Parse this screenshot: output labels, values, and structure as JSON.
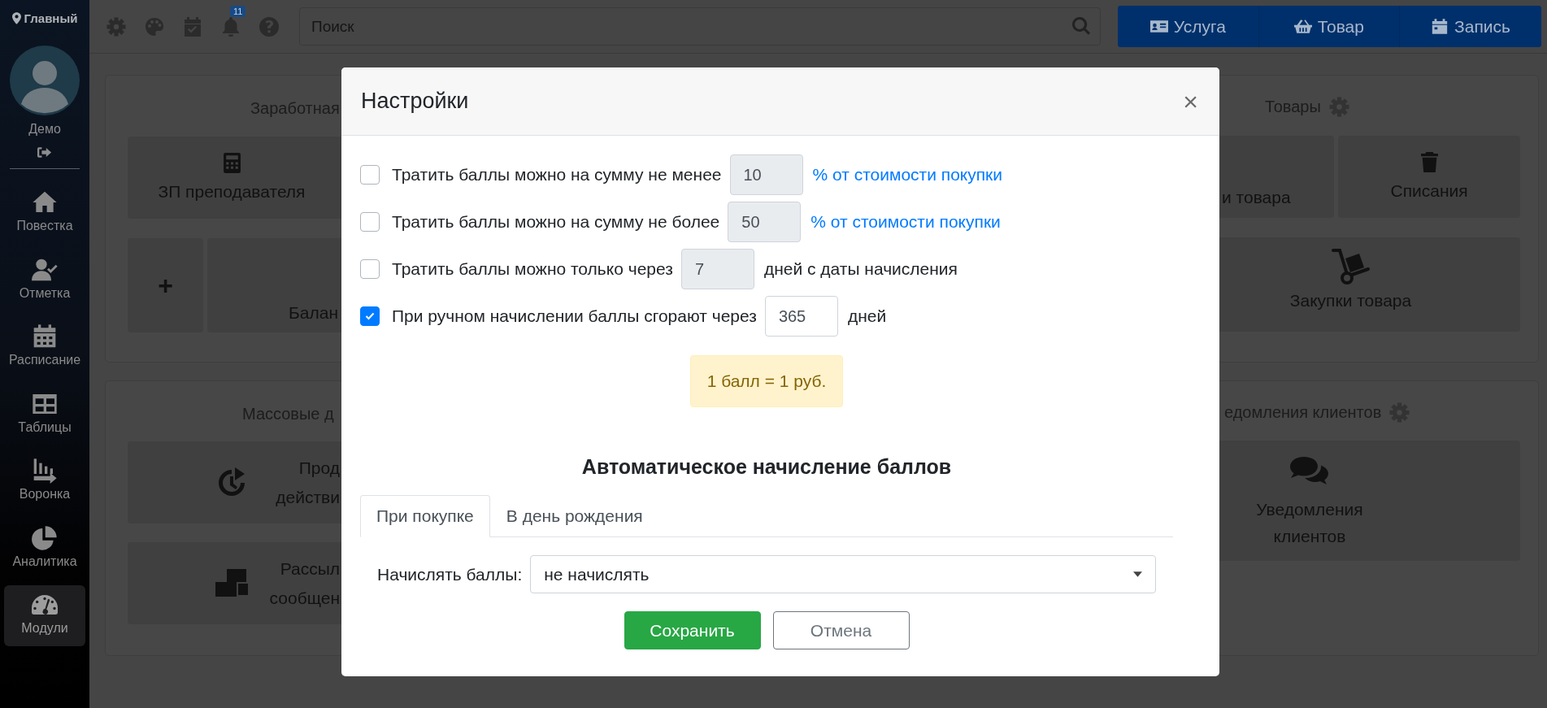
{
  "sidebar": {
    "location": "Главный",
    "user": "Демо",
    "items": [
      {
        "label": "Повестка",
        "selected": false
      },
      {
        "label": "Отметка",
        "selected": false
      },
      {
        "label": "Расписание",
        "selected": false
      },
      {
        "label": "Таблицы",
        "selected": false
      },
      {
        "label": "Воронка",
        "selected": false
      },
      {
        "label": "Аналитика",
        "selected": false
      },
      {
        "label": "Модули",
        "selected": true
      }
    ]
  },
  "topbar": {
    "notifications": "11",
    "search": {
      "placeholder": "Поиск"
    },
    "actions": [
      {
        "label": "Услуга"
      },
      {
        "label": "Товар"
      },
      {
        "label": "Запись"
      }
    ]
  },
  "salary_card": {
    "title": "Заработная",
    "tile": "ЗП преподавателя",
    "add_tile": "+",
    "balance_tile": "Балан"
  },
  "mass_card": {
    "title": "Массовые д",
    "tiles": [
      {
        "lines": [
          "Прод",
          "действи"
        ]
      },
      {
        "lines": [
          "Рассыл",
          "сообщен"
        ]
      }
    ]
  },
  "goods_card": {
    "title": "Товары",
    "tiles": [
      {
        "label": "и товара"
      },
      {
        "label": "Списания"
      },
      {
        "label": "Закупки товара"
      }
    ]
  },
  "notify_card": {
    "title": "едомления клиентов",
    "tile": "Уведомления клиентов"
  },
  "modal": {
    "title": "Настройки",
    "close": "×",
    "options": [
      {
        "label": "Тратить баллы можно на сумму не менее",
        "checked": false,
        "value": "10",
        "suffix": {
          "text": "% от стоимости покупки",
          "kind": "link"
        }
      },
      {
        "label": "Тратить баллы можно на сумму не более",
        "checked": false,
        "value": "50",
        "suffix": {
          "text": "% от стоимости покупки",
          "kind": "link"
        }
      },
      {
        "label": "Тратить баллы можно только через",
        "checked": false,
        "value": "7",
        "suffix": {
          "text": "дней с даты начисления",
          "kind": "text"
        }
      },
      {
        "label": "При ручном начислении баллы сгорают через",
        "checked": true,
        "value": "365",
        "suffix": {
          "text": "дней",
          "kind": "text"
        }
      }
    ],
    "rate_note": "1 балл = 1 руб.",
    "auto_title": "Автоматическое начисление баллов",
    "tabs": [
      {
        "label": "При покупке",
        "selected": true
      },
      {
        "label": "В день рождения",
        "selected": false
      }
    ],
    "accrual": {
      "label": "Начислять баллы:",
      "value": "не начислять"
    },
    "buttons": [
      {
        "label": "Сохранить",
        "kind": "primary"
      },
      {
        "label": "Отмена",
        "kind": "secondary"
      }
    ]
  }
}
